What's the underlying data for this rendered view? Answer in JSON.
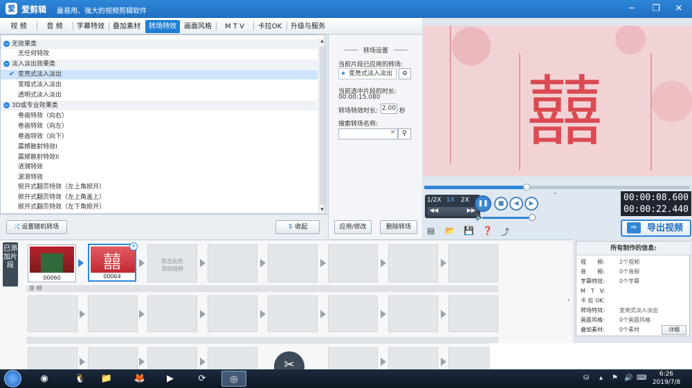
{
  "app": {
    "title": "爱剪辑",
    "subtitle": "最易用、强大的视频剪辑软件",
    "logo": "爱"
  },
  "window_controls": [
    "─",
    "❐",
    "✕"
  ],
  "tabs": [
    {
      "label": "视 频"
    },
    {
      "label": "音 频"
    },
    {
      "label": "字幕特效"
    },
    {
      "label": "叠加素材"
    },
    {
      "label": "转场特效",
      "active": true
    },
    {
      "label": "画面风格"
    },
    {
      "label": "M T V"
    },
    {
      "label": "卡拉OK"
    },
    {
      "label": "升级与服务"
    }
  ],
  "effect_list": {
    "categories": [
      {
        "label": "无效果类",
        "items": [
          "无任何特效"
        ]
      },
      {
        "label": "淡入淡出效果类",
        "items": [
          "变亮式淡入淡出",
          "变暗式淡入淡出",
          "透明式淡入淡出"
        ]
      },
      {
        "label": "3D或专业效果类",
        "items": [
          "卷画特效（向右）",
          "卷画特效（向左）",
          "卷画特效（向下）",
          "震撼散射特效I",
          "震撼散射特效II",
          "涟漪特效",
          "波浪特效",
          "掀开式翻页特效（左上角掀开）",
          "掀开式翻页特效（左上角盖上）",
          "掀开式翻页特效（左下角掀开）"
        ]
      }
    ],
    "selected": "变亮式淡入淡出"
  },
  "buttons": {
    "random": "设置随机转场",
    "collapse": "收起",
    "apply": "应用/修改",
    "delete": "删除转场"
  },
  "settings": {
    "title": "转场设置",
    "applied_label": "当前片段已应用的转场:",
    "applied_value": "变亮式淡入淡出",
    "duration_label": "当前选中片段的时长:",
    "duration_value": "00:00:15.080",
    "effect_duration_label": "转场特效时长:",
    "effect_duration_value": "2.00",
    "effect_duration_unit": "秒",
    "search_label": "搜索转场名称:",
    "search_value": ""
  },
  "preview": {
    "glyph": "囍",
    "progress": 0.385,
    "speeds": [
      "1/2X",
      "1X",
      "2X"
    ],
    "active_speed": "1X",
    "time_current": "00:00:08.600",
    "time_total": "00:00:22.440",
    "volume": 0.9,
    "export_label": "导出视频"
  },
  "timeline": {
    "tab_label": "已添加片段",
    "clips": [
      {
        "label": "00060"
      },
      {
        "label": "00064",
        "selected": true
      }
    ],
    "add_hint": [
      "双击此处",
      "添加视频"
    ],
    "audio_label": "音 频"
  },
  "info": {
    "title": "所有制作的信息:",
    "rows": [
      {
        "k": "视　　频:",
        "v": "2个视频"
      },
      {
        "k": "音　　频:",
        "v": "0个音频"
      },
      {
        "k": "字幕特效:",
        "v": "0个字幕"
      },
      {
        "k": "M　T　V:",
        "v": ""
      },
      {
        "k": "卡 拉 OK:",
        "v": ""
      },
      {
        "k": "转场特效:",
        "v": "变亮式淡入淡出"
      },
      {
        "k": "画面风格:",
        "v": "0个画面风格"
      },
      {
        "k": "叠加素材:",
        "v": "0个素材"
      }
    ],
    "detail": "详细"
  },
  "taskbar": {
    "time": "6:26",
    "date": "2019/7/8"
  }
}
